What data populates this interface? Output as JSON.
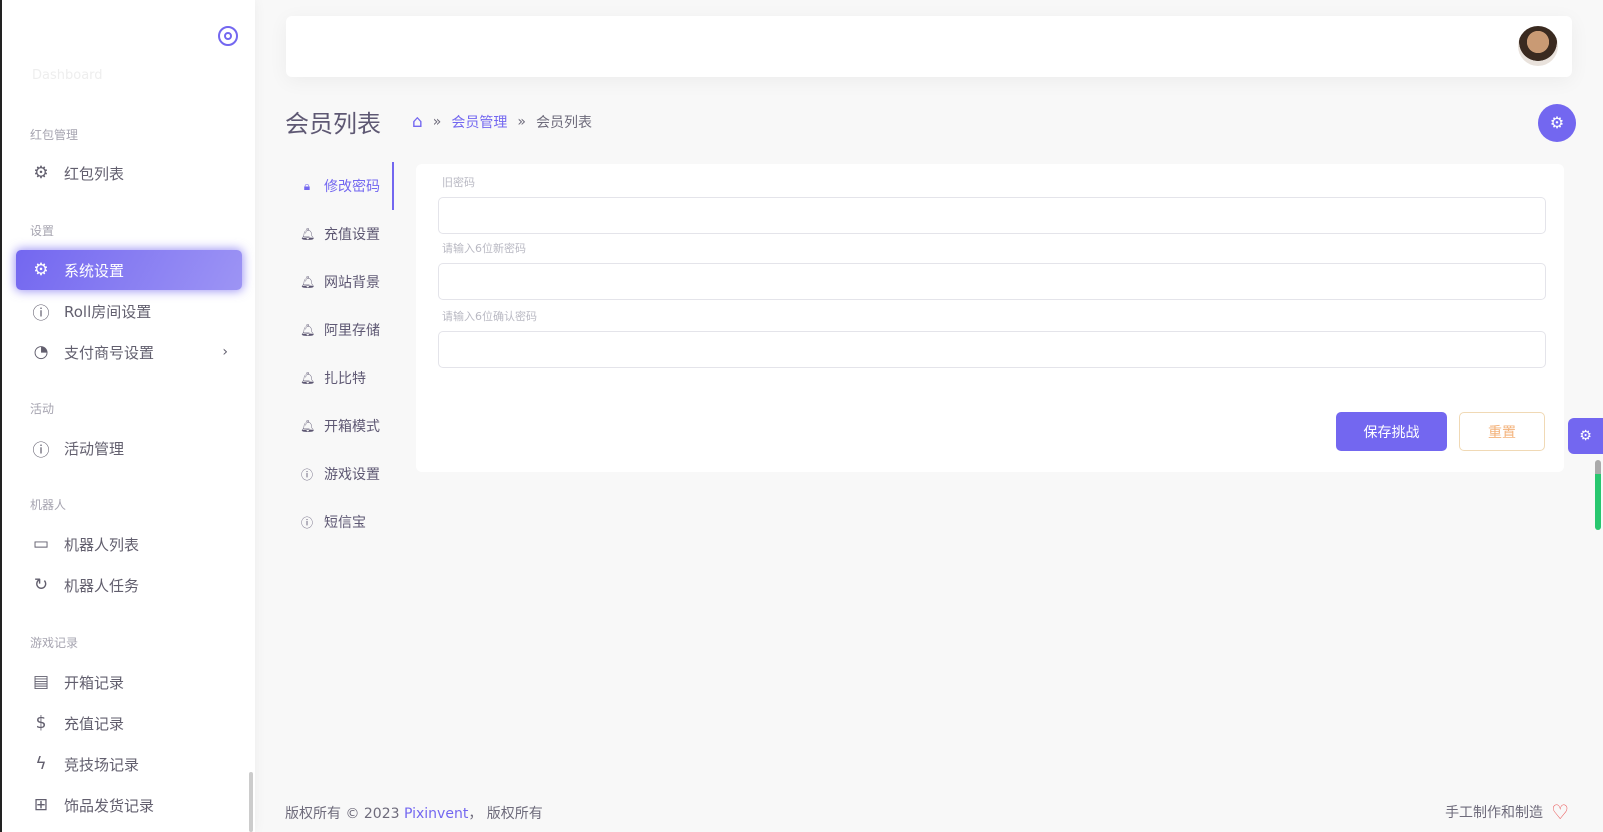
{
  "sidebar": {
    "faded_item": "Dashboard",
    "sections": [
      {
        "title": "红包管理",
        "items": [
          {
            "label": "红包列表",
            "icon": "gear-icon"
          }
        ]
      },
      {
        "title": "设置",
        "items": [
          {
            "label": "系统设置",
            "icon": "gear-icon",
            "active": true
          },
          {
            "label": "Roll房间设置",
            "icon": "info-icon"
          },
          {
            "label": "支付商号设置",
            "icon": "pie-chart-icon",
            "chevron": "›"
          }
        ]
      },
      {
        "title": "活动",
        "items": [
          {
            "label": "活动管理",
            "icon": "info-icon"
          }
        ]
      },
      {
        "title": "机器人",
        "items": [
          {
            "label": "机器人列表",
            "icon": "monitor-icon"
          },
          {
            "label": "机器人任务",
            "icon": "refresh-icon"
          }
        ]
      },
      {
        "title": "游戏记录",
        "items": [
          {
            "label": "开箱记录",
            "icon": "archive-icon"
          },
          {
            "label": "充值记录",
            "icon": "dollar-icon"
          },
          {
            "label": "竞技场记录",
            "icon": "zap-icon"
          },
          {
            "label": "饰品发货记录",
            "icon": "layout-icon"
          }
        ]
      }
    ]
  },
  "page": {
    "title": "会员列表",
    "breadcrumb": [
      "会员管理",
      "会员列表"
    ],
    "sep": "»"
  },
  "tabs": [
    {
      "label": "修改密码",
      "icon": "lock-icon",
      "active": true
    },
    {
      "label": "充值设置",
      "icon": "bell-icon"
    },
    {
      "label": "网站背景",
      "icon": "bell-icon"
    },
    {
      "label": "阿里存储",
      "icon": "bell-icon"
    },
    {
      "label": "扎比特",
      "icon": "bell-icon"
    },
    {
      "label": "开箱模式",
      "icon": "bell-icon"
    },
    {
      "label": "游戏设置",
      "icon": "info-icon"
    },
    {
      "label": "短信宝",
      "icon": "info-icon"
    }
  ],
  "form": {
    "old_label": "旧密码",
    "old_value": "",
    "new_label": "请输入6位新密码",
    "new_value": "",
    "confirm_label": "请输入6位确认密码",
    "confirm_value": "",
    "save": "保存挑战",
    "reset": "重置"
  },
  "footer": {
    "left_prefix": "版权所有 © 2023 ",
    "brand": "Pixinvent",
    "left_suffix": "， 版权所有",
    "right": "手工制作和制造"
  },
  "colors": {
    "primary": "#7367f0",
    "reset": "#f3b27a"
  }
}
